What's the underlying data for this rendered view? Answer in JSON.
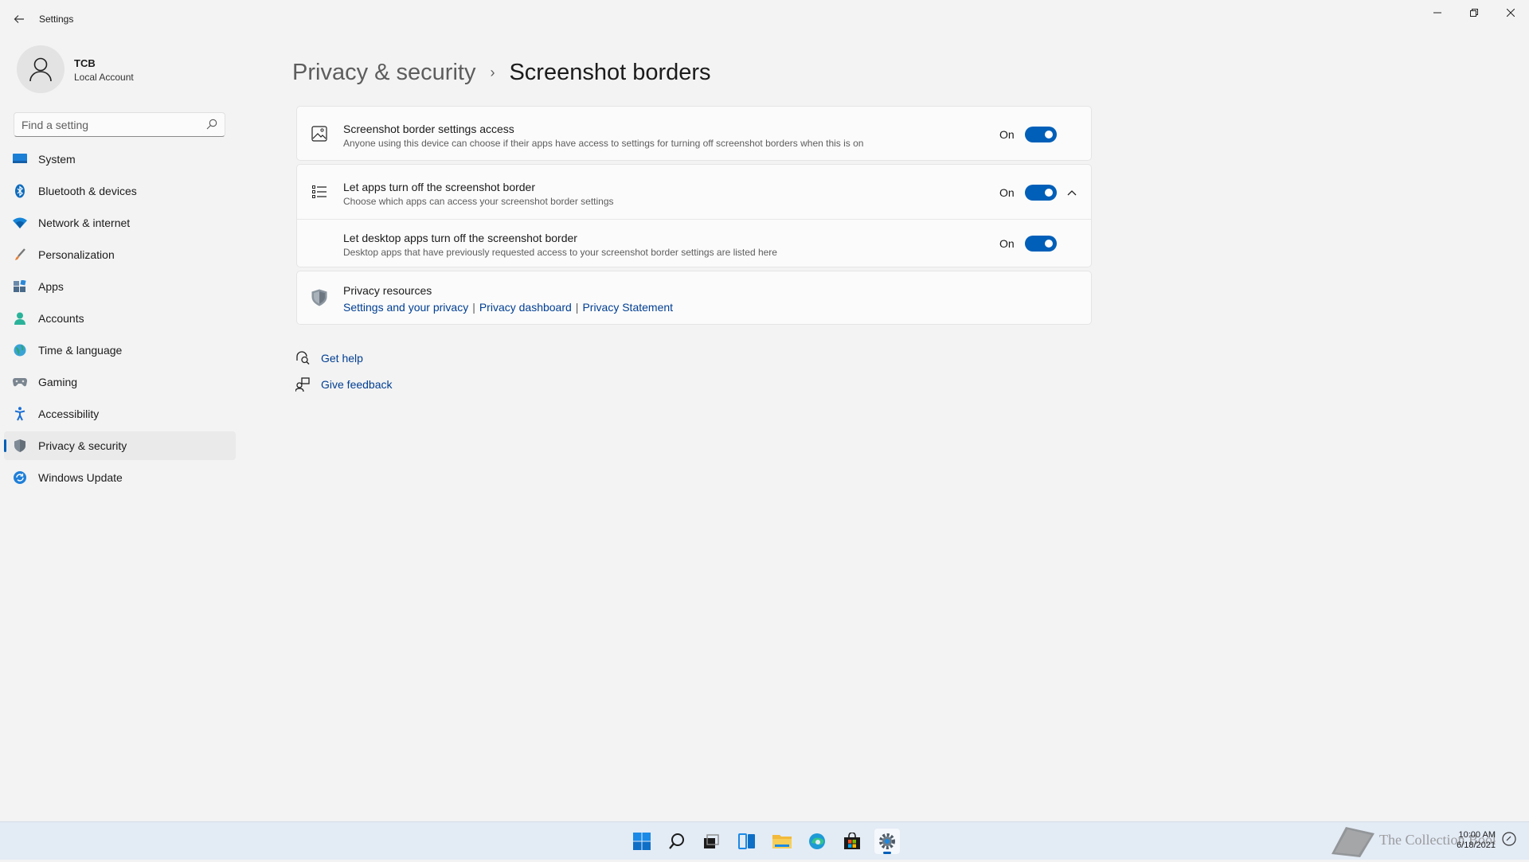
{
  "window": {
    "title": "Settings",
    "minimize": "—",
    "maximize": "❐",
    "close": "✕"
  },
  "account": {
    "name": "TCB",
    "type": "Local Account"
  },
  "search": {
    "placeholder": "Find a setting",
    "value": ""
  },
  "sidebar": {
    "items": [
      {
        "label": "System",
        "icon": "system-icon"
      },
      {
        "label": "Bluetooth & devices",
        "icon": "bluetooth-icon"
      },
      {
        "label": "Network & internet",
        "icon": "wifi-icon"
      },
      {
        "label": "Personalization",
        "icon": "brush-icon"
      },
      {
        "label": "Apps",
        "icon": "apps-icon"
      },
      {
        "label": "Accounts",
        "icon": "accounts-icon"
      },
      {
        "label": "Time & language",
        "icon": "globe-icon"
      },
      {
        "label": "Gaming",
        "icon": "gamepad-icon"
      },
      {
        "label": "Accessibility",
        "icon": "accessibility-icon"
      },
      {
        "label": "Privacy & security",
        "icon": "shield-icon",
        "active": true
      },
      {
        "label": "Windows Update",
        "icon": "update-icon"
      }
    ]
  },
  "header": {
    "parent": "Privacy & security",
    "separator": "›",
    "current": "Screenshot borders"
  },
  "settings": {
    "access": {
      "title": "Screenshot border settings access",
      "description": "Anyone using this device can choose if their apps have access to settings for turning off screenshot borders when this is on",
      "state": "On",
      "enabled": true
    },
    "apps": {
      "title": "Let apps turn off the screenshot border",
      "description": "Choose which apps can access your screenshot border settings",
      "state": "On",
      "enabled": true,
      "expanded": true
    },
    "desktop_apps": {
      "title": "Let desktop apps turn off the screenshot border",
      "description": "Desktop apps that have previously requested access to your screenshot border settings are listed here",
      "state": "On",
      "enabled": true
    }
  },
  "privacy_resources": {
    "title": "Privacy resources",
    "links": [
      "Settings and your privacy",
      "Privacy dashboard",
      "Privacy Statement"
    ],
    "separator": "|"
  },
  "help": {
    "get_help": "Get help",
    "give_feedback": "Give feedback"
  },
  "taskbar": {
    "apps": [
      "start-icon",
      "search-icon",
      "task-view-icon",
      "widgets-icon",
      "file-explorer-icon",
      "edge-icon",
      "store-icon",
      "settings-icon"
    ],
    "active": "settings-icon",
    "time": "10:00 AM",
    "date": "6/18/2021"
  },
  "colors": {
    "accent": "#005fb8",
    "link": "#003e92",
    "background": "#f3f3f3",
    "card": "#fbfbfb"
  }
}
